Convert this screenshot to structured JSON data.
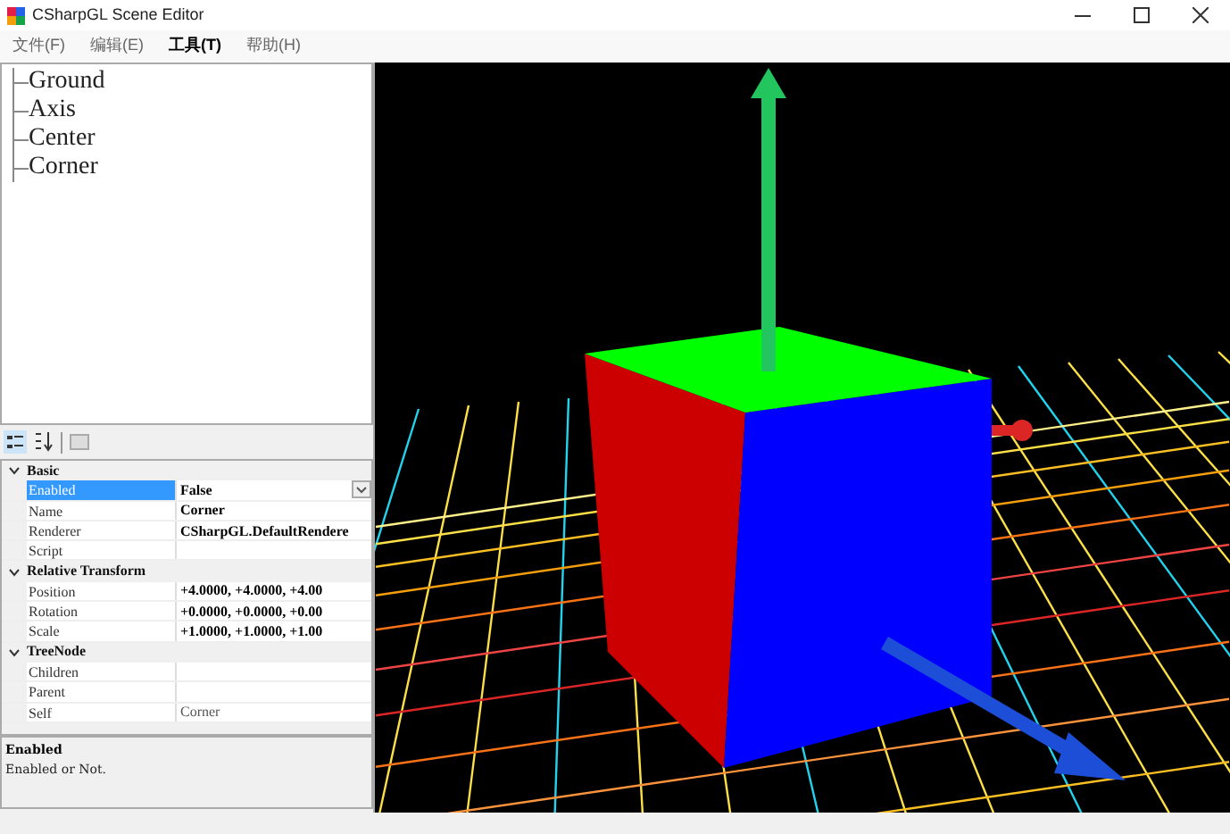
{
  "window": {
    "title": "CSharpGL Scene Editor"
  },
  "menu": [
    {
      "label": "文件(F)",
      "selected": false
    },
    {
      "label": "编辑(E)",
      "selected": false
    },
    {
      "label": "工具(T)",
      "selected": true
    },
    {
      "label": "帮助(H)",
      "selected": false
    }
  ],
  "tree": {
    "items": [
      {
        "label": "Ground"
      },
      {
        "label": "Axis"
      },
      {
        "label": "Center"
      },
      {
        "label": "Corner"
      }
    ]
  },
  "property_grid": {
    "categories": [
      {
        "name": "Basic",
        "expanded": true,
        "properties": [
          {
            "name": "Enabled",
            "value": "False",
            "selected": true,
            "bold": true,
            "dropdown": true
          },
          {
            "name": "Name",
            "value": "Corner",
            "selected": false,
            "bold": true
          },
          {
            "name": "Renderer",
            "value": "CSharpGL.DefaultRendere",
            "selected": false,
            "bold": true
          },
          {
            "name": "Script",
            "selected": false
          }
        ]
      },
      {
        "name": "Relative Transform",
        "expanded": true,
        "properties": [
          {
            "name": "Position",
            "value": "+4.0000,  +4.0000,  +4.00",
            "selected": false,
            "bold": true
          },
          {
            "name": "Rotation",
            "value": "+0.0000,  +0.0000,  +0.00",
            "selected": false,
            "bold": true
          },
          {
            "name": "Scale",
            "value": "+1.0000,  +1.0000,  +1.00",
            "selected": false,
            "bold": true
          }
        ]
      },
      {
        "name": "TreeNode",
        "expanded": true,
        "properties": [
          {
            "name": "Children",
            "selected": false
          },
          {
            "name": "Parent",
            "selected": false
          },
          {
            "name": "Self",
            "value": "Corner",
            "selected": false,
            "bold": false
          }
        ]
      }
    ],
    "description": {
      "title": "Enabled",
      "text": "Enabled or Not."
    }
  }
}
